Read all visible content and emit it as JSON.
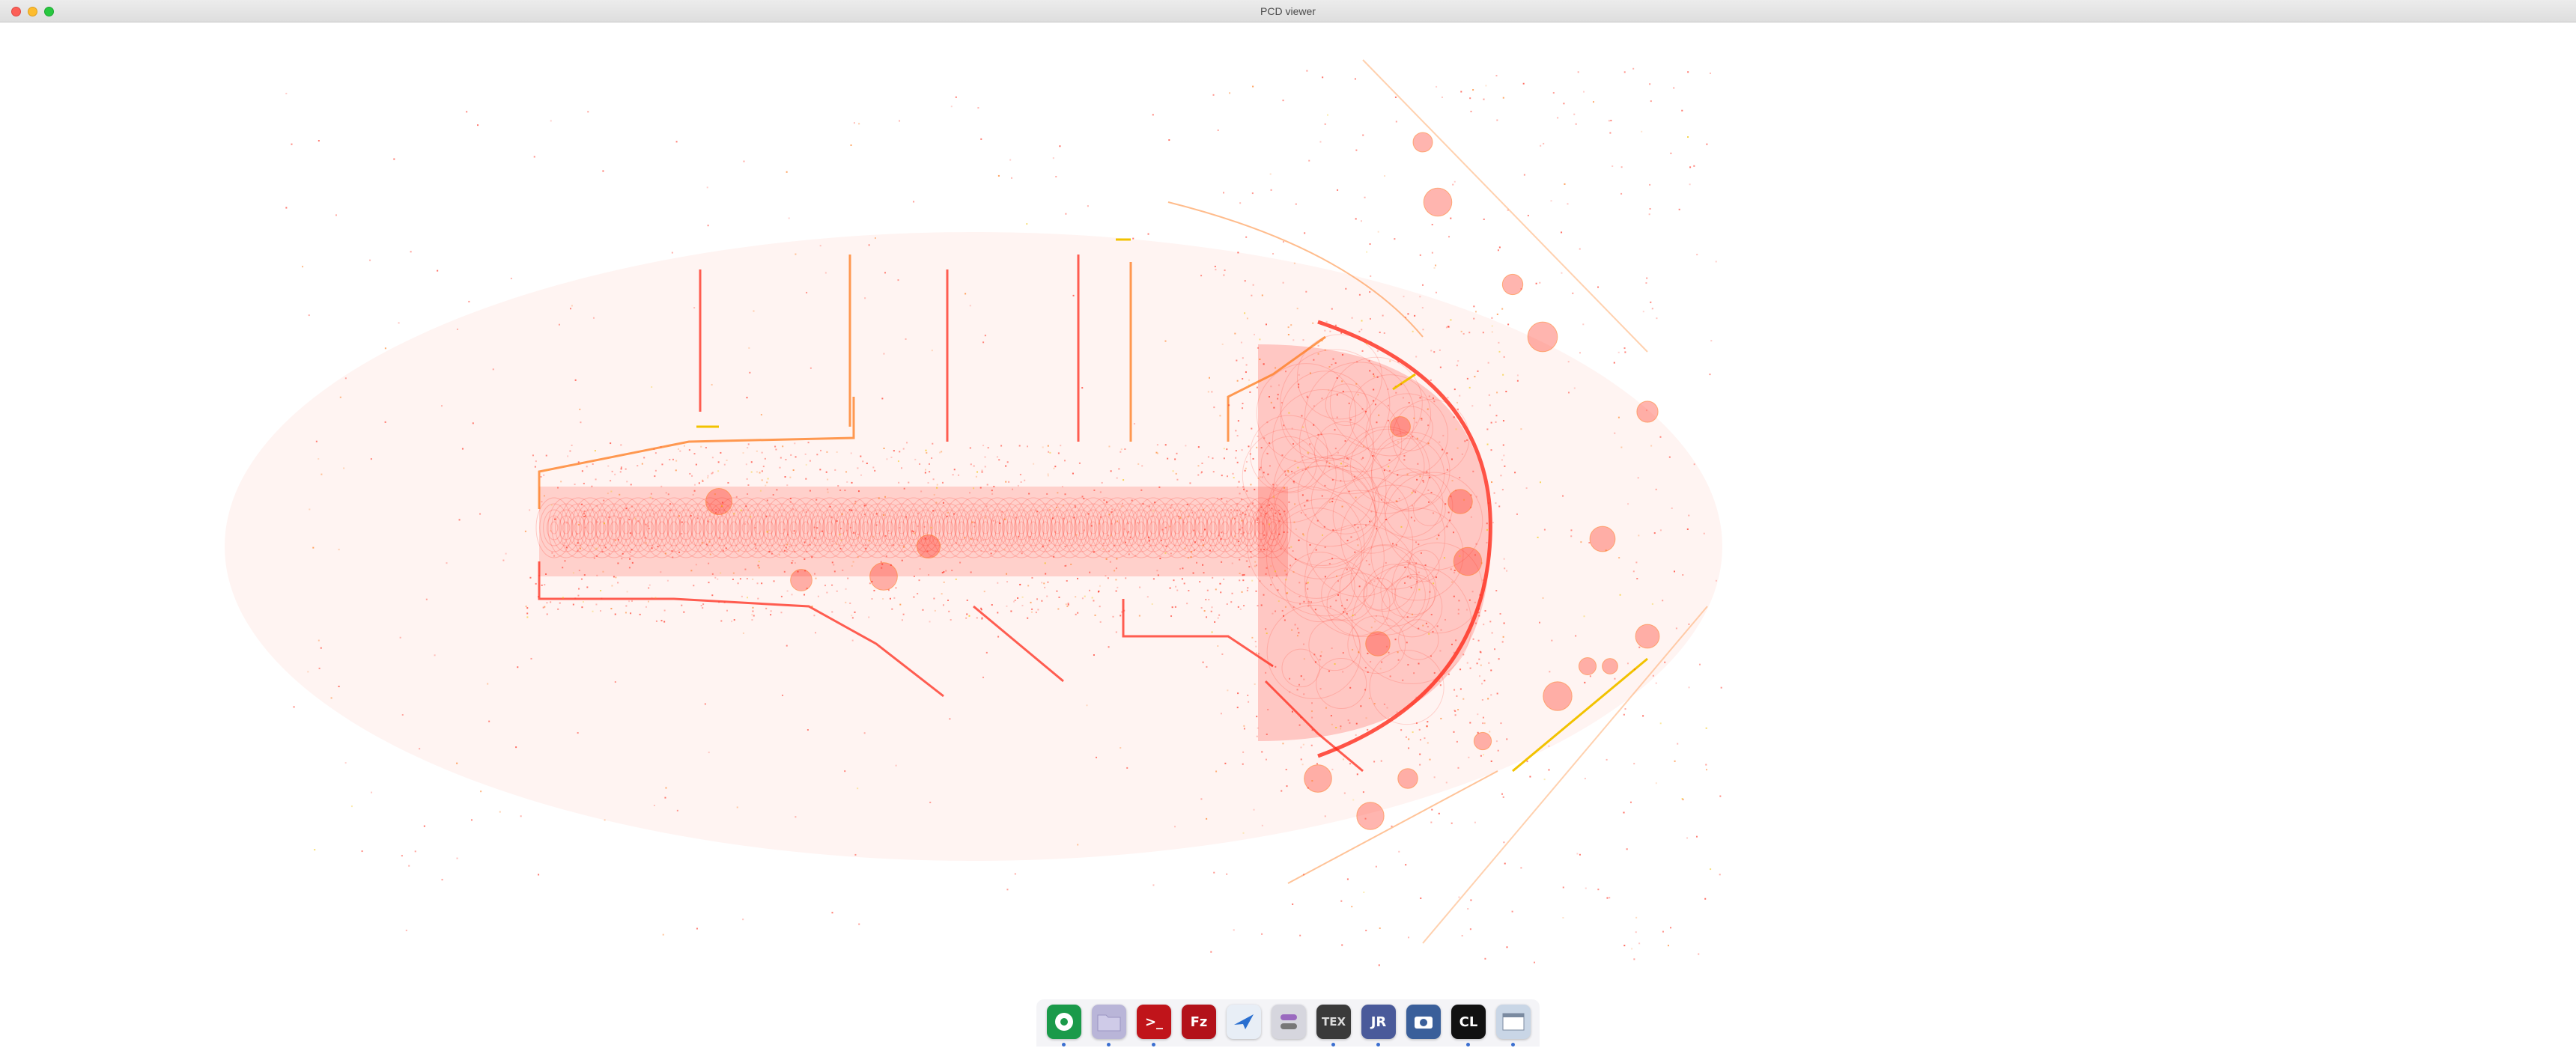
{
  "window": {
    "title": "PCD viewer"
  },
  "viewport": {
    "content": "point-cloud-map",
    "colors": {
      "primary": "#ff2a1a",
      "secondary": "#ff7a1a",
      "highlight": "#f2c200",
      "background": "#ffffff"
    }
  },
  "dock": {
    "items": [
      {
        "name": "Chrome",
        "icon": "chrome-icon",
        "color": "#1a9a4a",
        "label": "",
        "running": true
      },
      {
        "name": "Finder",
        "icon": "folder-icon",
        "color": "#b9b5d8",
        "label": "",
        "running": true
      },
      {
        "name": "Terminal",
        "icon": "terminal-icon",
        "color": "#c0141a",
        "label": ">_",
        "running": true
      },
      {
        "name": "FileZilla",
        "icon": "filezilla-icon",
        "color": "#b3121a",
        "label": "Fz",
        "running": false
      },
      {
        "name": "Mail",
        "icon": "mail-icon",
        "color": "#e8eef6",
        "label": "",
        "running": false
      },
      {
        "name": "Settings",
        "icon": "toggle-icon",
        "color": "#d6d6de",
        "label": "",
        "running": false
      },
      {
        "name": "TeX",
        "icon": "tex-icon",
        "color": "#3a3a3a",
        "label": "TEX",
        "running": true
      },
      {
        "name": "J Editor",
        "icon": "jr-icon",
        "color": "#4a5a9a",
        "label": "JR",
        "running": true
      },
      {
        "name": "Screenshot",
        "icon": "camera-icon",
        "color": "#3a5f9a",
        "label": "",
        "running": false
      },
      {
        "name": "CLion",
        "icon": "clion-icon",
        "color": "#111111",
        "label": "CL",
        "running": true
      },
      {
        "name": "Window",
        "icon": "window-icon",
        "color": "#c9d6e6",
        "label": "",
        "running": true
      }
    ]
  }
}
